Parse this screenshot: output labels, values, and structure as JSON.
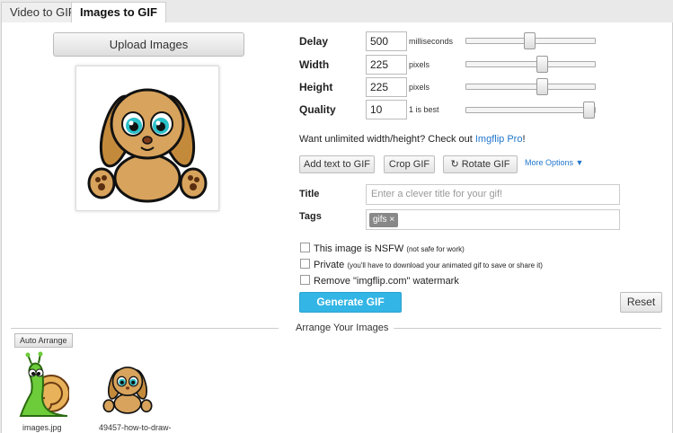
{
  "tabs": [
    {
      "label": "Video to GIF",
      "active": false
    },
    {
      "label": "Images to GIF",
      "active": true
    }
  ],
  "upload": {
    "label": "Upload Images"
  },
  "settings": {
    "delay": {
      "label": "Delay",
      "value": "500",
      "unit": "milliseconds",
      "level": 0.49
    },
    "width": {
      "label": "Width",
      "value": "225",
      "unit": "pixels",
      "level": 0.6
    },
    "height": {
      "label": "Height",
      "value": "225",
      "unit": "pixels",
      "level": 0.6
    },
    "quality": {
      "label": "Quality",
      "value": "10",
      "unit": "1 is best",
      "level": 1.0
    }
  },
  "promo": {
    "text": "Want unlimited width/height? Check out ",
    "link": "Imgflip Pro",
    "suffix": "!"
  },
  "actions": {
    "add_text": "Add text to GIF",
    "crop": "Crop GIF",
    "rotate": "Rotate GIF",
    "more": "More Options ▼"
  },
  "title_field": {
    "label": "Title",
    "placeholder": "Enter a clever title for your gif!"
  },
  "tags_field": {
    "label": "Tags",
    "tags": [
      "gifs ×"
    ]
  },
  "options": {
    "nsfw": {
      "label": "This image is NSFW",
      "note": "(not safe for work)"
    },
    "private": {
      "label": "Private",
      "note": "(you'll have to download your animated gif to save or share it)"
    },
    "watermark": {
      "label": "Remove \"imgflip.com\" watermark"
    }
  },
  "generate": {
    "label": "Generate GIF"
  },
  "reset": {
    "label": "Reset"
  },
  "arrange": {
    "title": "Arrange Your Images",
    "auto_label": "Auto Arrange",
    "images": [
      {
        "name": "images.jpg"
      },
      {
        "name": "49457-how-to-draw-"
      }
    ]
  },
  "colors": {
    "accent": "#33b5e5",
    "link": "#2277cc"
  }
}
